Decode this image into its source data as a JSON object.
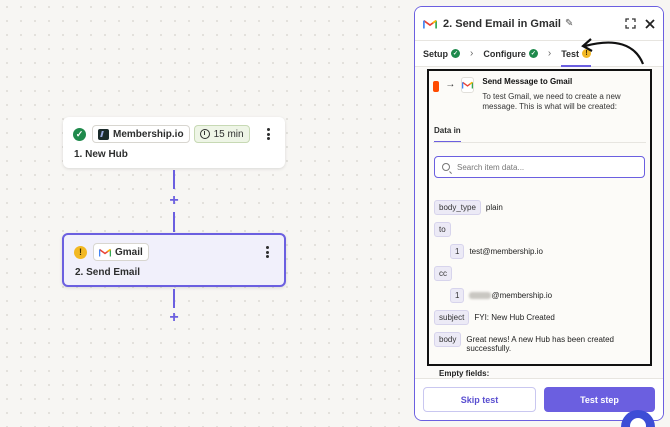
{
  "canvas": {
    "step1": {
      "app": "Membership.io",
      "delay": "15 min",
      "title": "1. New Hub"
    },
    "step2": {
      "app": "Gmail",
      "title": "2. Send Email"
    },
    "add_step_symbol": "+"
  },
  "panel": {
    "title": "2. Send Email in Gmail",
    "tabs": [
      {
        "label": "Setup"
      },
      {
        "label": "Configure"
      },
      {
        "label": "Test"
      }
    ],
    "message": {
      "title": "Send Message to Gmail",
      "description": "To test Gmail, we need to create a new message. This is what will be created:"
    },
    "data_tab": "Data in",
    "search_placeholder": "Search item data...",
    "fields": {
      "body_type_key": "body_type",
      "body_type_val": "plain",
      "to_key": "to",
      "to_index": "1",
      "to_val": "test@membership.io",
      "cc_key": "cc",
      "cc_index": "1",
      "cc_val_suffix": "@membership.io",
      "subject_key": "subject",
      "subject_val": "FYI: New Hub Created",
      "body_key": "body",
      "body_val": "Great news! A new Hub has been created successfully."
    },
    "empty_fields_label": "Empty fields:",
    "buttons": {
      "skip": "Skip test",
      "test": "Test step"
    }
  },
  "colors": {
    "accent": "#6b5fe0",
    "success": "#1f8a4c",
    "warning": "#f2b824",
    "zapier_orange": "#ff4a00"
  }
}
